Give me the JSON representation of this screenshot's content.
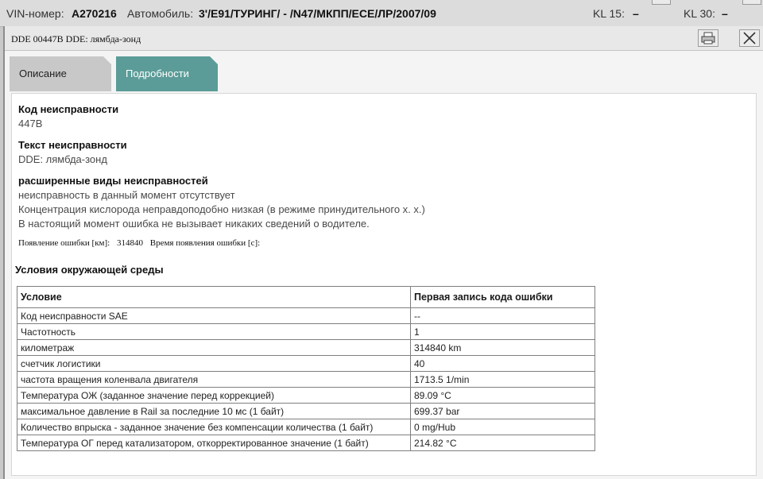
{
  "topbar": {
    "vin_label": "VIN-номер:",
    "vin_value": "A270216",
    "car_label": "Автомобиль:",
    "car_value": "3'/E91/ТУРИНГ/ - /N47/МКПП/ECE/ЛР/2007/09",
    "kl15_label": "KL 15:",
    "kl15_value": "–",
    "kl30_label": "KL 30:",
    "kl30_value": "–"
  },
  "dialog": {
    "title": "DDE 00447B DDE: лямбда-зонд",
    "tabs": [
      {
        "label": "Описание",
        "active": false
      },
      {
        "label": "Подробности",
        "active": true
      }
    ],
    "accent_color": "#5b9c98"
  },
  "details": {
    "fault_code_label": "Код неисправности",
    "fault_code_value": "447B",
    "fault_text_label": "Текст неисправности",
    "fault_text_value": "DDE: лямбда-зонд",
    "extended_label": "расширенные виды неисправностей",
    "extended_lines": [
      "неисправность в данный момент отсутствует",
      "Концентрация кислорода неправдоподобно низкая (в режиме принудительного х. х.)",
      "В настоящий момент ошибка не вызывает никаких сведений о водителе."
    ],
    "occurrence_km_label": "Появление ошибки [км]:",
    "occurrence_km_value": "314840",
    "occurrence_time_label": "Время появления ошибки [с]:"
  },
  "environment": {
    "title": "Условия окружающей среды",
    "columns": [
      "Условие",
      "Первая запись кода ошибки"
    ],
    "rows": [
      [
        "Код неисправности SAE",
        "--"
      ],
      [
        "Частотность",
        "1"
      ],
      [
        "километраж",
        "314840 km"
      ],
      [
        "счетчик логистики",
        "40"
      ],
      [
        "частота вращения коленвала двигателя",
        "1713.5 1/min"
      ],
      [
        "Температура ОЖ (заданное значение перед коррекцией)",
        "89.09 °C"
      ],
      [
        "максимальное давление в Rail за последние 10 мс (1 байт)",
        "699.37 bar"
      ],
      [
        "Количество впрыска - заданное значение без компенсации количества (1 байт)",
        "0 mg/Hub"
      ],
      [
        "Температура ОГ перед катализатором, откорректированное значение (1 байт)",
        "214.82 °C"
      ]
    ]
  }
}
